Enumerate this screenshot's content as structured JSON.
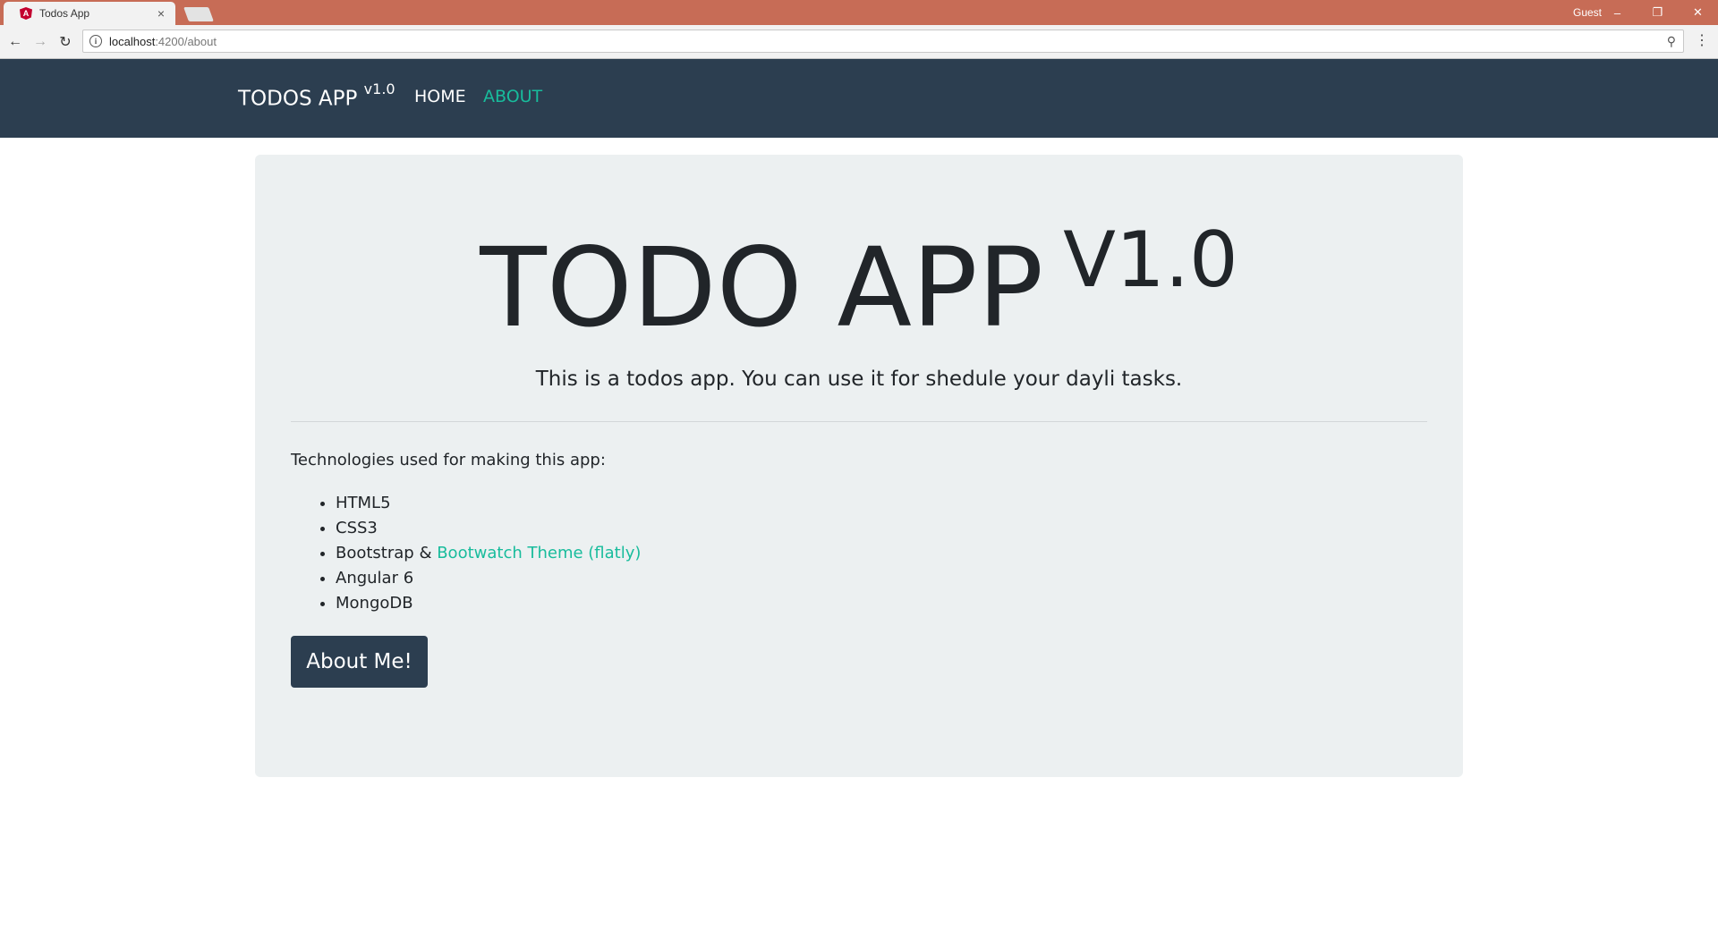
{
  "browser": {
    "tab_title": "Todos App",
    "tab_close": "×",
    "user_label": "Guest",
    "url_host": "localhost",
    "url_path": ":4200/about",
    "win_minimize": "–",
    "win_restore": "❐",
    "win_close": "✕",
    "back_icon": "←",
    "forward_icon": "→",
    "reload_icon": "↻",
    "zoom_icon": "⚲",
    "menu_icon": "⋮",
    "info_icon": "i",
    "favicon_letter": "A",
    "tabstrip_color": "#c76c56"
  },
  "navbar": {
    "brand": "TODOS APP",
    "brand_version": "v1.0",
    "links": [
      {
        "label": "HOME",
        "color": "#ffffff"
      },
      {
        "label": "ABOUT",
        "color": "#18bc9c"
      }
    ],
    "bg_color": "#2c3e50"
  },
  "main": {
    "title": "TODO APP",
    "title_version": "V1.0",
    "lead": "This is a todos app. You can use it for shedule your dayli tasks.",
    "tech_intro": "Technologies used for making this app:",
    "technologies": [
      {
        "text": "HTML5"
      },
      {
        "text": "CSS3"
      },
      {
        "text": "Bootstrap & ",
        "link": "Bootwatch Theme (flatly)"
      },
      {
        "text": "Angular 6"
      },
      {
        "text": "MongoDB"
      }
    ],
    "about_button": "About Me!",
    "accent_color": "#18bc9c",
    "panel_color": "#ecf0f1"
  }
}
